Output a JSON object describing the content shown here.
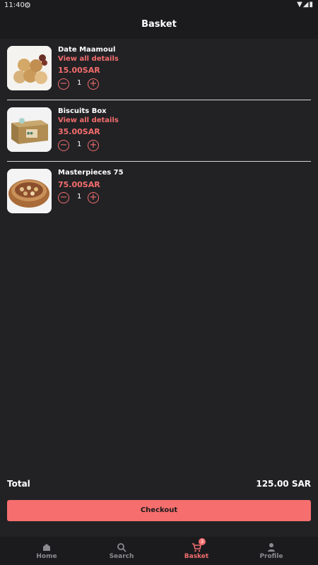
{
  "status_bar": {
    "time": "11:40"
  },
  "header": {
    "title": "Basket"
  },
  "items": [
    {
      "name": "Date Maamoul",
      "details": "View all details",
      "price": "15.00SAR",
      "qty": "1",
      "thumb": "maamoul-image"
    },
    {
      "name": "Biscuits Box",
      "details": "View all details",
      "price": "35.00SAR",
      "qty": "1",
      "thumb": "biscuits-box-image"
    },
    {
      "name": "Masterpieces 75",
      "details": "",
      "price": "75.00SAR",
      "qty": "1",
      "thumb": "masterpieces-image"
    }
  ],
  "summary": {
    "total_label": "Total",
    "total_value": "125.00 SAR",
    "checkout_label": "Checkout"
  },
  "nav": {
    "items": [
      {
        "label": "Home",
        "icon": "home-icon"
      },
      {
        "label": "Search",
        "icon": "search-icon"
      },
      {
        "label": "Basket",
        "icon": "cart-icon",
        "badge": "3",
        "active": true
      },
      {
        "label": "Profile",
        "icon": "person-icon"
      }
    ]
  },
  "colors": {
    "accent": "#f36d6d",
    "background": "#222225",
    "bar": "#1b1b1e"
  }
}
